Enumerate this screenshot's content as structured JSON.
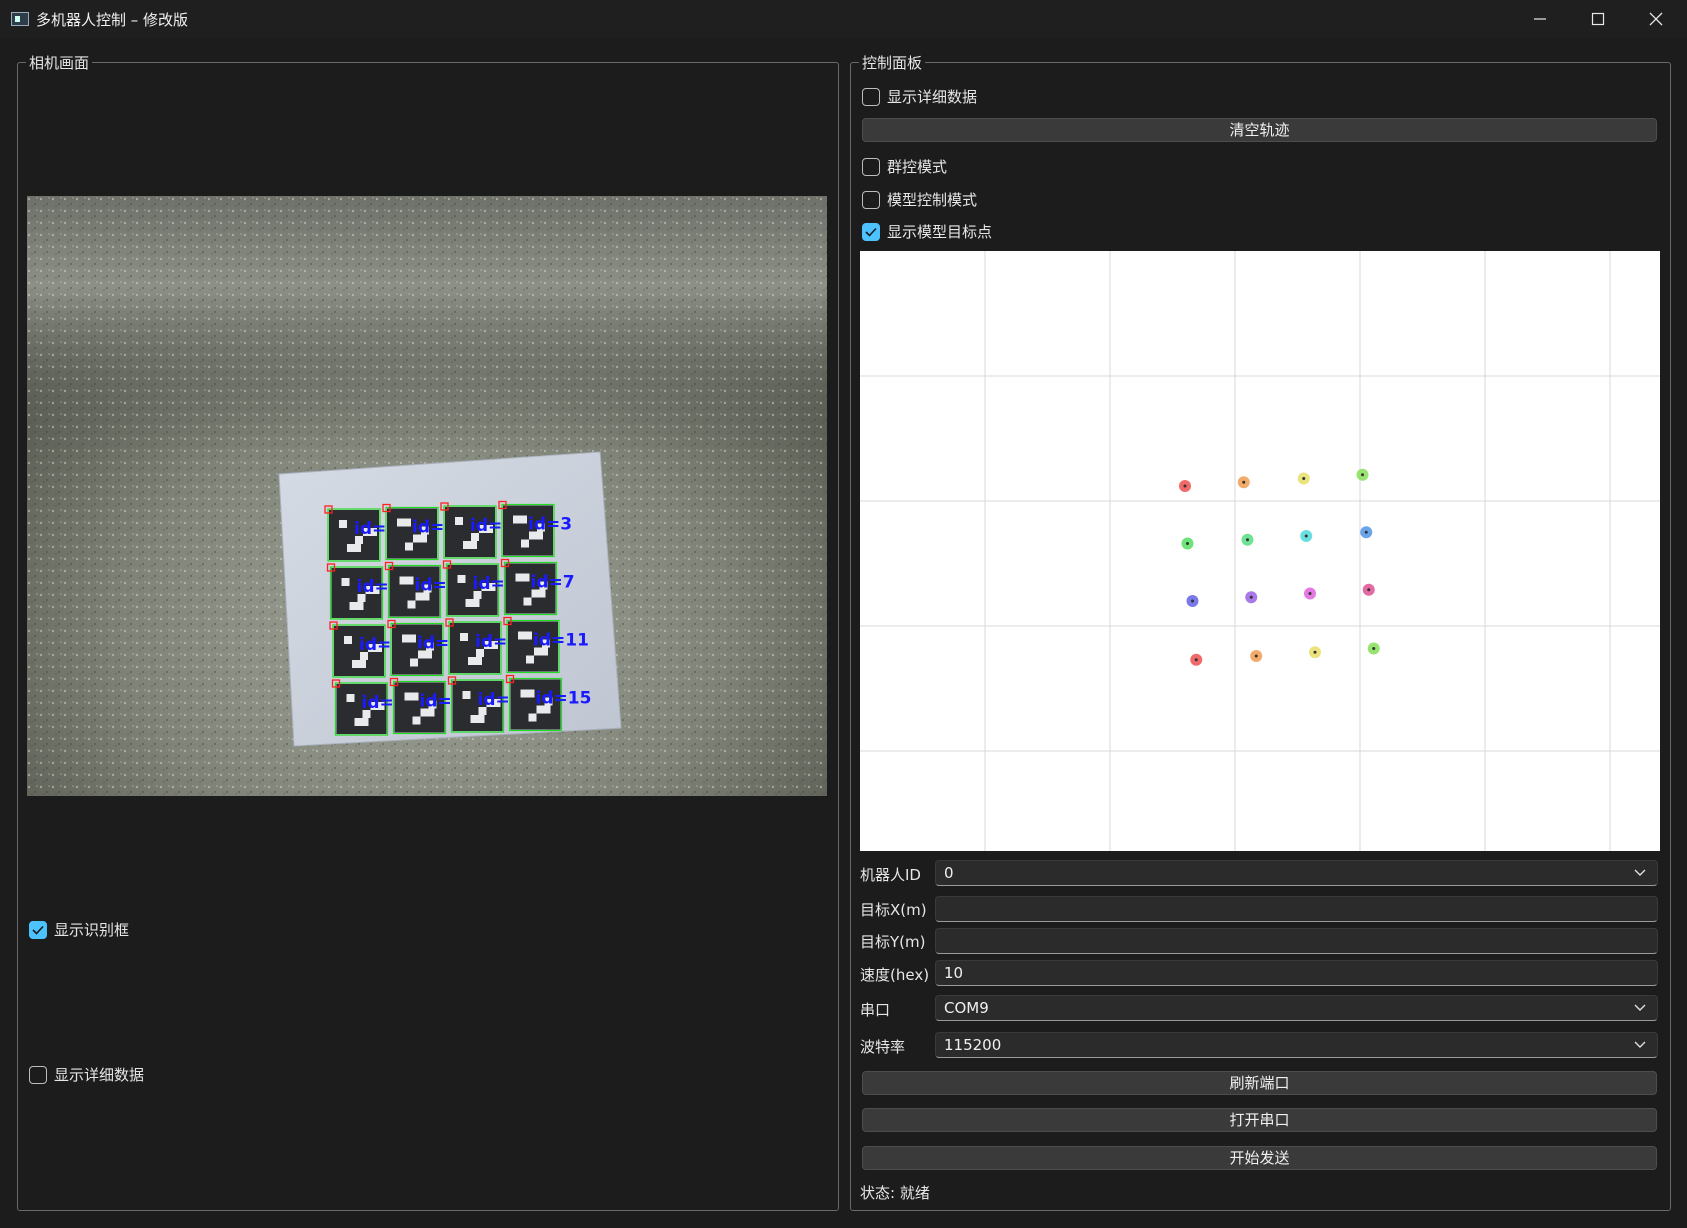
{
  "window": {
    "title": "多机器人控制 – 修改版",
    "controls": [
      "minimize-icon",
      "maximize-icon",
      "close-icon"
    ]
  },
  "camera_group": {
    "title": "相机画面",
    "markers": [
      "id=0",
      "id=1",
      "id=2",
      "id=3",
      "id=4",
      "id=5",
      "id=6",
      "id=7",
      "id=8",
      "id=9",
      "id=10",
      "id=11",
      "id=12",
      "id=13",
      "id=14",
      "id=15"
    ],
    "show_boxes": {
      "label": "显示识别框",
      "checked": true
    },
    "show_detail": {
      "label": "显示详细数据",
      "checked": false
    }
  },
  "control_group": {
    "title": "控制面板",
    "show_detail": {
      "label": "显示详细数据",
      "checked": false
    },
    "clear_button": "清空轨迹",
    "swarm_mode": {
      "label": "群控模式",
      "checked": false
    },
    "model_mode": {
      "label": "模型控制模式",
      "checked": false
    },
    "show_targets": {
      "label": "显示模型目标点",
      "checked": true
    },
    "robot_id": {
      "label": "机器人ID",
      "value": "0"
    },
    "target_x": {
      "label": "目标X(m)",
      "value": ""
    },
    "target_y": {
      "label": "目标Y(m)",
      "value": ""
    },
    "speed": {
      "label": "速度(hex)",
      "value": "10"
    },
    "port": {
      "label": "串口",
      "value": "COM9"
    },
    "baud": {
      "label": "波特率",
      "value": "115200"
    },
    "refresh_button": "刷新端口",
    "open_button": "打开串口",
    "send_button": "开始发送",
    "status": "状态: 就绪"
  },
  "colors": {
    "accent": "#4cc2ff",
    "window_bg": "#1c1c1c",
    "marker_label": "#1a1aff",
    "marker_box": "#22dd22",
    "marker_corner": "#ff2020"
  },
  "chart_data": {
    "type": "scatter",
    "grid": true,
    "points": [
      {
        "x": 2.6,
        "y": 2.12,
        "color": "#ef5a5a"
      },
      {
        "x": 3.07,
        "y": 2.15,
        "color": "#f0a25a"
      },
      {
        "x": 3.55,
        "y": 2.18,
        "color": "#e8e070"
      },
      {
        "x": 4.02,
        "y": 2.21,
        "color": "#8ee060"
      },
      {
        "x": 2.62,
        "y": 1.66,
        "color": "#5ee06a"
      },
      {
        "x": 3.1,
        "y": 1.69,
        "color": "#5ee08a"
      },
      {
        "x": 3.57,
        "y": 1.72,
        "color": "#5adcdc"
      },
      {
        "x": 4.05,
        "y": 1.75,
        "color": "#5a9ae8"
      },
      {
        "x": 2.66,
        "y": 1.2,
        "color": "#6a6ae8"
      },
      {
        "x": 3.13,
        "y": 1.23,
        "color": "#a06ae8"
      },
      {
        "x": 3.6,
        "y": 1.26,
        "color": "#e06ae0"
      },
      {
        "x": 4.07,
        "y": 1.29,
        "color": "#e05a98"
      },
      {
        "x": 2.69,
        "y": 0.73,
        "color": "#ef5a5a"
      },
      {
        "x": 3.17,
        "y": 0.76,
        "color": "#f0a25a"
      },
      {
        "x": 3.64,
        "y": 0.79,
        "color": "#e8e070"
      },
      {
        "x": 4.11,
        "y": 0.82,
        "color": "#8ee060"
      }
    ]
  }
}
